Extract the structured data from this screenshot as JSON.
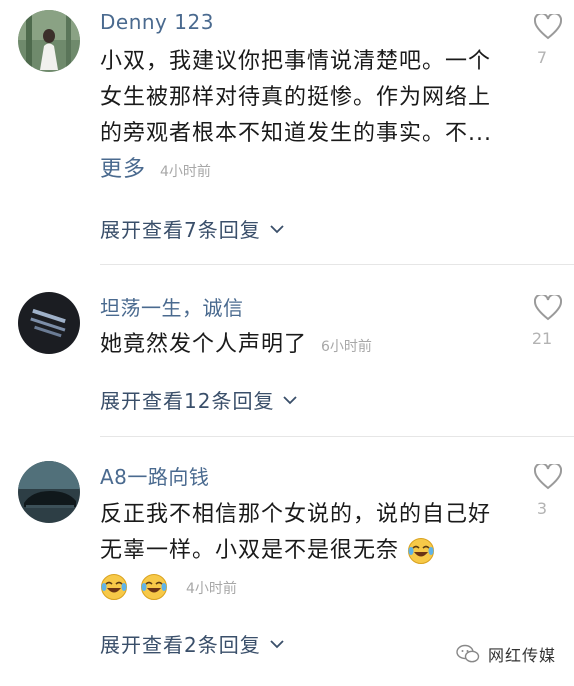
{
  "comments": [
    {
      "username": "Denny 123",
      "text": "小双，我建议你把事情说清楚吧。一个女生被那样对待真的挺惨。作为网络上的旁观者根本不知道发生的事实。不...",
      "more_label": "更多",
      "time": "4小时前",
      "likes": "7",
      "replies_label": "展开查看7条回复"
    },
    {
      "username": "坦荡一生，诚信",
      "text": "她竟然发个人声明了",
      "time": "6小时前",
      "likes": "21",
      "replies_label": "展开查看12条回复"
    },
    {
      "username": "A8一路向钱",
      "text": "反正我不相信那个女说的，说的自己好无辜一样。小双是不是很无奈",
      "time": "4小时前",
      "likes": "3",
      "replies_label": "展开查看2条回复"
    }
  ],
  "watermark": "网红传媒",
  "icons": {
    "like": "heart-outline-icon",
    "expand": "chevron-down-icon",
    "emoji": "tears-of-joy-emoji",
    "watermark": "wechat-icon"
  },
  "colors": {
    "username": "#4a6a8f",
    "secondary": "#a8a8a8"
  }
}
